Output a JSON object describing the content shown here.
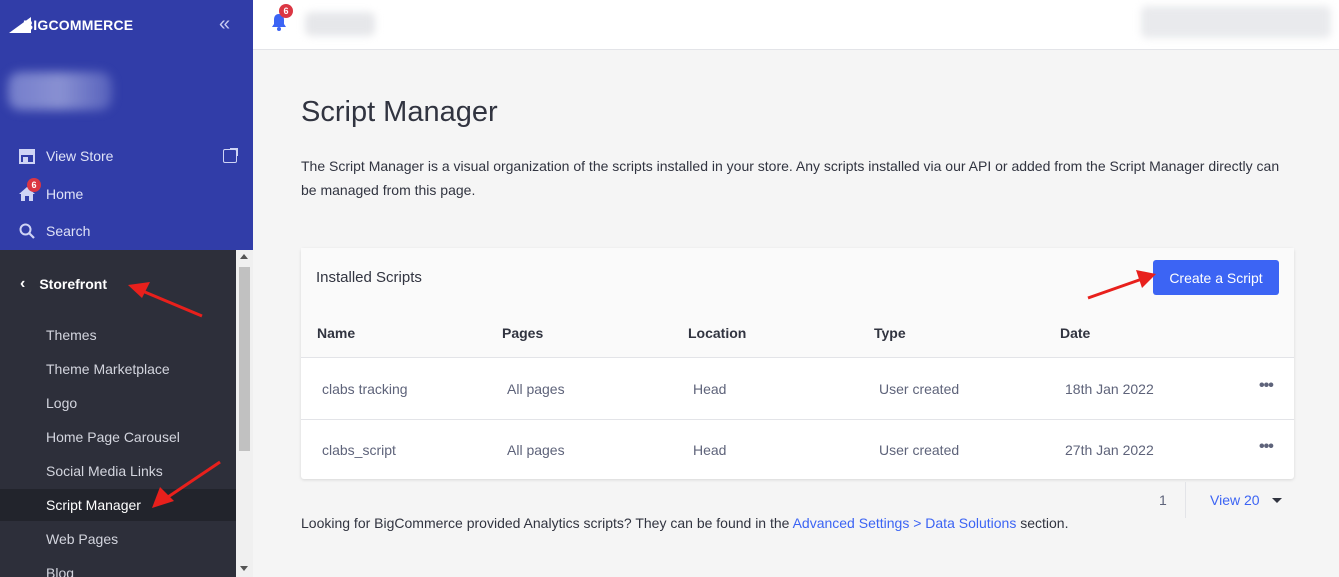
{
  "brand": {
    "logo_text": "BIGCOMMERCE"
  },
  "sidebar": {
    "collapse_icon": "double-chevron-left-icon",
    "top_links": [
      {
        "label": "View Store",
        "icon": "storefront-icon"
      },
      {
        "label": "Home",
        "icon": "home-icon",
        "badge": "6"
      },
      {
        "label": "Search",
        "icon": "search-icon"
      }
    ],
    "section": {
      "label": "Storefront",
      "icon": "chevron-left-icon"
    },
    "items": [
      {
        "label": "Themes"
      },
      {
        "label": "Theme Marketplace"
      },
      {
        "label": "Logo"
      },
      {
        "label": "Home Page Carousel"
      },
      {
        "label": "Social Media Links"
      },
      {
        "label": "Script Manager",
        "active": true
      },
      {
        "label": "Web Pages"
      },
      {
        "label": "Blog"
      }
    ]
  },
  "topbar": {
    "notification_badge": "6"
  },
  "main": {
    "title": "Script Manager",
    "description": "The Script Manager is a visual organization of the scripts installed in your store. Any scripts installed via our API or added from the Script Manager directly can be managed from this page.",
    "card": {
      "title": "Installed Scripts",
      "create_button": "Create a Script",
      "columns": [
        "Name",
        "Pages",
        "Location",
        "Type",
        "Date"
      ],
      "rows": [
        {
          "name": "clabs tracking",
          "pages": "All pages",
          "location": "Head",
          "type": "User created",
          "date": "18th Jan 2022",
          "actions": "•••"
        },
        {
          "name": "clabs_script",
          "pages": "All pages",
          "location": "Head",
          "type": "User created",
          "date": "27th Jan 2022",
          "actions": "•••"
        }
      ]
    },
    "pagination": {
      "page": "1",
      "view": "View 20"
    },
    "footer": {
      "prefix": "Looking for BigCommerce provided Analytics scripts? They can be found in the ",
      "link": "Advanced Settings > Data Solutions",
      "suffix": " section."
    }
  },
  "colors": {
    "sidebar_top": "#313da8",
    "sidebar_bottom": "#2d2f3a",
    "accent": "#3c64f4",
    "badge": "#db3643",
    "annotation_arrow": "#e8201c"
  }
}
